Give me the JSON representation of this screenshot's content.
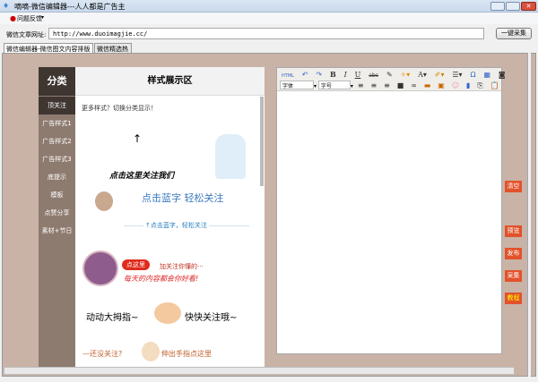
{
  "window": {
    "title": "嘀嘀-微信编辑器---人人都是广告主"
  },
  "menu": {
    "feedback": "问题反馈"
  },
  "url": {
    "label": "微信文章网址:",
    "value": "http://www.duoimagjie.cc/",
    "collect_button": "一键采集"
  },
  "tabs": [
    {
      "label": "微信编辑器-微信图文内容排版系统"
    },
    {
      "label": "微信精选热文"
    }
  ],
  "sidebar": {
    "title": "分类",
    "items": [
      "顶关注",
      "广告样式1",
      "广告样式2",
      "广告样式3",
      "底提示",
      "模板",
      "点赞分享",
      "素材+节日"
    ]
  },
  "display": {
    "title": "样式展示区",
    "hint": "更多样式？切换分类显示！",
    "samples": [
      "点击这里关注我们",
      "点击蓝字 轻松关注",
      "↑点击蓝字，轻松关注",
      "点这里",
      "加关注你懂的···",
      "每天的内容都会你好看!",
      "动动大拇指~",
      "快快关注哦~",
      "—还没关注?",
      "伸出手指点这里"
    ]
  },
  "editor": {
    "toolbar": {
      "html": "HTML",
      "bold": "B",
      "italic": "I",
      "underline": "U",
      "font_color": "A",
      "font_family": "字体",
      "font_size": "字号"
    }
  },
  "right_buttons": [
    {
      "label": "清空"
    },
    {
      "label": "预览"
    },
    {
      "label": "发布"
    },
    {
      "label": "采集"
    },
    {
      "label": "教程"
    }
  ],
  "colors": {
    "accent": "#e2522b",
    "sidebar": "#8e7b6f",
    "sidebar_head": "#3f3632",
    "background": "#c9b3a6"
  }
}
